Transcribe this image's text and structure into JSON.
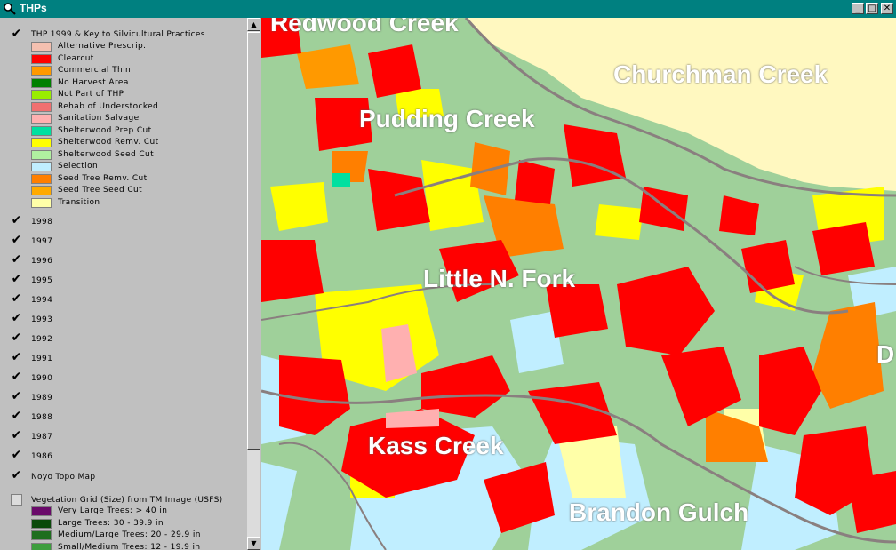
{
  "window": {
    "title": "THPs",
    "minimize_glyph": "_",
    "maximize_glyph": "□",
    "close_glyph": "✕"
  },
  "toc": {
    "main_layer": {
      "label": "THP 1999 & Key to Silvicultural Practices",
      "checked": true,
      "legend": [
        {
          "label": "Alternative Prescrip.",
          "color": "#f4c0b0"
        },
        {
          "label": "Clearcut",
          "color": "#ff0000"
        },
        {
          "label": "Commercial Thin",
          "color": "#ff9900"
        },
        {
          "label": "No Harvest Area",
          "color": "#008000"
        },
        {
          "label": "Not Part of THP",
          "color": "#99ee00"
        },
        {
          "label": "Rehab of Understocked",
          "color": "#f07070"
        },
        {
          "label": "Sanitation Salvage",
          "color": "#ffb0b0"
        },
        {
          "label": "Shelterwood Prep Cut",
          "color": "#00e0a0"
        },
        {
          "label": "Shelterwood Remv. Cut",
          "color": "#ffff00"
        },
        {
          "label": "Shelterwood Seed Cut",
          "color": "#b0f0a0"
        },
        {
          "label": "Selection",
          "color": "#c0eeff"
        },
        {
          "label": "Seed Tree Remv. Cut",
          "color": "#ff7f00"
        },
        {
          "label": "Seed Tree Seed Cut",
          "color": "#ffaa00"
        },
        {
          "label": "Transition",
          "color": "#ffffa8"
        }
      ]
    },
    "year_layers": [
      {
        "label": "1998",
        "checked": true
      },
      {
        "label": "1997",
        "checked": true
      },
      {
        "label": "1996",
        "checked": true
      },
      {
        "label": "1995",
        "checked": true
      },
      {
        "label": "1994",
        "checked": true
      },
      {
        "label": "1993",
        "checked": true
      },
      {
        "label": "1992",
        "checked": true
      },
      {
        "label": "1991",
        "checked": true
      },
      {
        "label": "1990",
        "checked": true
      },
      {
        "label": "1989",
        "checked": true
      },
      {
        "label": "1988",
        "checked": true
      },
      {
        "label": "1987",
        "checked": true
      },
      {
        "label": "1986",
        "checked": true
      }
    ],
    "topo_layer": {
      "label": "Noyo Topo Map",
      "checked": true
    },
    "veg_layer": {
      "label": "Vegetation Grid (Size) from TM Image (USFS)",
      "checked": false,
      "legend": [
        {
          "label": "Very Large Trees: > 40  in",
          "color": "#6a0a6a"
        },
        {
          "label": "Large Trees: 30 - 39.9 in",
          "color": "#0a4a0a"
        },
        {
          "label": "Medium/Large Trees: 20 - 29.9 in",
          "color": "#1e6e1e"
        },
        {
          "label": "Small/Medium Trees: 12 - 19.9 in",
          "color": "#3e9e3e"
        }
      ]
    }
  },
  "map": {
    "place_labels": [
      "Redwood Creek",
      "Churchman Creek",
      "Pudding Creek",
      "Little N. Fork",
      "Kass Creek",
      "Brandon Gulch",
      "D"
    ],
    "colors": {
      "background": "#9fd09a",
      "clearcut": "#ff0000",
      "shelterwood_remv": "#ffff00",
      "selection": "#c0eeff",
      "seed_tree_remv": "#ff7f00",
      "transition": "#ffffa8",
      "sanitation": "#ffb0b0",
      "boundary": "#808080"
    }
  }
}
